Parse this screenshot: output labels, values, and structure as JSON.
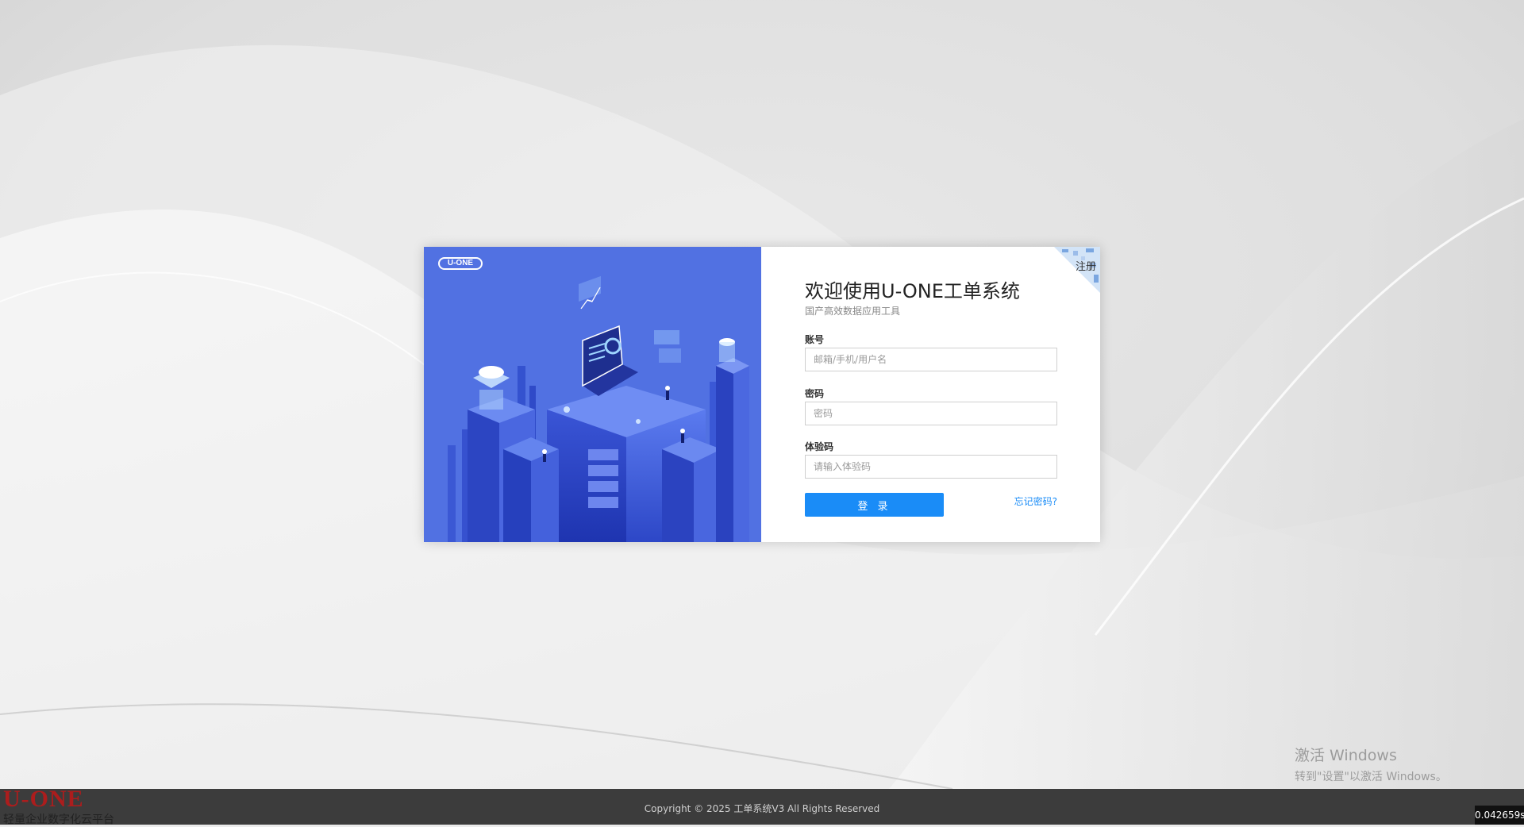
{
  "brand": {
    "logo_text": "U-ONE"
  },
  "login": {
    "register_label": "注册",
    "title": "欢迎使用U-ONE工单系统",
    "subtitle": "国产高效数据应用工具",
    "account_label": "账号",
    "account_placeholder": "邮箱/手机/用户名",
    "password_label": "密码",
    "password_placeholder": "密码",
    "code_label": "体验码",
    "code_placeholder": "请输入体验码",
    "login_button": "登 录",
    "forgot_link": "忘记密码?"
  },
  "footer": {
    "copyright": "Copyright © 2025 工单系统V3 All Rights Reserved",
    "corner_logo": "U-ONE",
    "corner_slogan": "轻量企业数字化云平台"
  },
  "windows_activation": {
    "title": "激活 Windows",
    "subtitle": "转到\"设置\"以激活 Windows。"
  },
  "timer": "0.042659s",
  "colors": {
    "primary": "#1a8cf7",
    "illustration_blue": "#4f6fe0",
    "footer_bg": "#3c3c3c",
    "corner_logo_red": "#c01818"
  }
}
